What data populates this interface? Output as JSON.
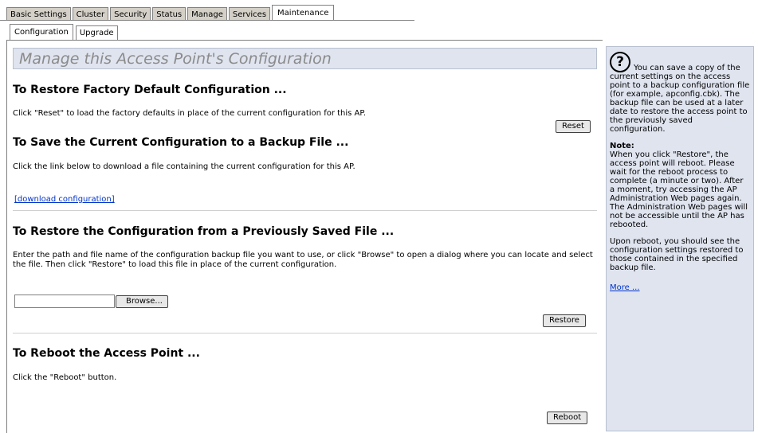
{
  "tabs": {
    "basic_settings": "Basic Settings",
    "cluster": "Cluster",
    "security": "Security",
    "status": "Status",
    "manage": "Manage",
    "services": "Services",
    "maintenance": "Maintenance"
  },
  "subtabs": {
    "configuration": "Configuration",
    "upgrade": "Upgrade"
  },
  "page_title": "Manage this Access Point's Configuration",
  "factory": {
    "heading": "To Restore Factory Default Configuration ...",
    "text": "Click \"Reset\" to load the factory defaults in place of the current configuration for this AP.",
    "button": "Reset"
  },
  "backup": {
    "heading": "To Save the Current Configuration to a Backup File ...",
    "text": "Click the link below to download a file containing the current configuration for this AP.",
    "link": "[download configuration]"
  },
  "restore": {
    "heading": "To Restore the Configuration from a Previously Saved File ...",
    "text": "Enter the path and file name of the configuration backup file you want to use, or click \"Browse\" to open a dialog where you can locate and select the file.  Then click \"Restore\" to load this file in place of the current configuration.",
    "browse": "Browse...",
    "button": "Restore",
    "file_value": ""
  },
  "reboot": {
    "heading": "To Reboot the Access Point ...",
    "text": "Click the \"Reboot\" button.",
    "button": "Reboot"
  },
  "help": {
    "icon": "?",
    "intro": "You can save a copy of the current settings on the access point to a backup configuration file (for example, apconfig.cbk). The backup file can be used at a later date to restore the access point to the previously saved configuration.",
    "note_title": "Note:",
    "note_text": "When you click \"Restore\", the access point will reboot. Please wait for the reboot process to complete (a minute or two). After a moment, try accessing the AP Administration Web pages again. The Administration Web pages will not be accessible until the AP has rebooted.",
    "reboot_text": "Upon reboot, you should see the configuration settings restored to those contained in the specified backup file.",
    "more": "More ..."
  }
}
